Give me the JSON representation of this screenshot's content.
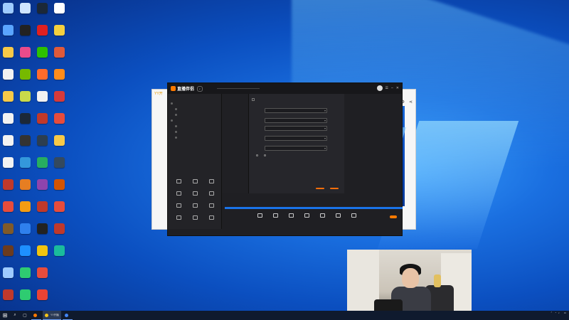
{
  "desktop": {
    "icons": [
      {
        "label": "",
        "icon": "recycle-bin-icon",
        "color": "#9ecbff"
      },
      {
        "label": "",
        "icon": "computer-icon",
        "color": "#cfe5ff"
      },
      {
        "label": "",
        "icon": "steam-icon",
        "color": "#1b2838"
      },
      {
        "label": "",
        "icon": "app-icon",
        "color": "#ffffff"
      },
      {
        "label": "",
        "icon": "network-icon",
        "color": "#5aa5ff"
      },
      {
        "label": "",
        "icon": "epic-icon",
        "color": "#222222"
      },
      {
        "label": "",
        "icon": "netease-icon",
        "color": "#e02020"
      },
      {
        "label": "",
        "icon": "game-icon",
        "color": "#f4d03f"
      },
      {
        "label": "",
        "icon": "folder-icon",
        "color": "#f7c948"
      },
      {
        "label": "",
        "icon": "app-icon",
        "color": "#e94b8b"
      },
      {
        "label": "",
        "icon": "wechat-icon",
        "color": "#2dc100"
      },
      {
        "label": "",
        "icon": "game-icon",
        "color": "#e05a3a"
      },
      {
        "label": "",
        "icon": "document-icon",
        "color": "#f2f2f2"
      },
      {
        "label": "",
        "icon": "nvidia-icon",
        "color": "#76b900"
      },
      {
        "label": "",
        "icon": "app-icon",
        "color": "#ff6b2b"
      },
      {
        "label": "",
        "icon": "app-icon",
        "color": "#ff8c1a"
      },
      {
        "label": "",
        "icon": "folder-icon",
        "color": "#f7c948"
      },
      {
        "label": "",
        "icon": "game-icon",
        "color": "#c9d94a"
      },
      {
        "label": "",
        "icon": "document-icon",
        "color": "#f2f2f2"
      },
      {
        "label": "",
        "icon": "game-icon",
        "color": "#d63a3a"
      },
      {
        "label": "",
        "icon": "document-icon",
        "color": "#f2f2f2"
      },
      {
        "label": "",
        "icon": "steam-icon",
        "color": "#1b2838"
      },
      {
        "label": "",
        "icon": "game-icon",
        "color": "#c0392b"
      },
      {
        "label": "",
        "icon": "game-icon",
        "color": "#e74c3c"
      },
      {
        "label": "",
        "icon": "document-icon",
        "color": "#f2f2f2"
      },
      {
        "label": "",
        "icon": "app-icon",
        "color": "#333333"
      },
      {
        "label": "",
        "icon": "app-icon",
        "color": "#2c3e50"
      },
      {
        "label": "",
        "icon": "folder-icon",
        "color": "#f7c948"
      },
      {
        "label": "",
        "icon": "document-icon",
        "color": "#f2f2f2"
      },
      {
        "label": "",
        "icon": "app-icon",
        "color": "#3498db"
      },
      {
        "label": "",
        "icon": "game-icon",
        "color": "#27ae60"
      },
      {
        "label": "",
        "icon": "game-icon",
        "color": "#34495e"
      },
      {
        "label": "",
        "icon": "game-icon",
        "color": "#c0392b"
      },
      {
        "label": "",
        "icon": "game-icon",
        "color": "#e67e22"
      },
      {
        "label": "",
        "icon": "game-icon",
        "color": "#8e44ad"
      },
      {
        "label": "",
        "icon": "game-icon",
        "color": "#d35400"
      },
      {
        "label": "",
        "icon": "game-icon",
        "color": "#e74c3c"
      },
      {
        "label": "",
        "icon": "game-icon",
        "color": "#f39c12"
      },
      {
        "label": "",
        "icon": "game-icon",
        "color": "#c0392b"
      },
      {
        "label": "",
        "icon": "game-icon",
        "color": "#e74c3c"
      },
      {
        "label": "",
        "icon": "game-icon",
        "color": "#7f5a2a"
      },
      {
        "label": "",
        "icon": "app-icon",
        "color": "#2f80ed"
      },
      {
        "label": "",
        "icon": "game-icon",
        "color": "#222222"
      },
      {
        "label": "",
        "icon": "game-icon",
        "color": "#c0392b"
      },
      {
        "label": "",
        "icon": "game-icon",
        "color": "#6b3b1f"
      },
      {
        "label": "",
        "icon": "qq-icon",
        "color": "#1e90ff"
      },
      {
        "label": "",
        "icon": "game-icon",
        "color": "#f1c40f"
      },
      {
        "label": "",
        "icon": "game-icon",
        "color": "#1abc9c"
      },
      {
        "label": "",
        "icon": "app-icon",
        "color": "#9ecbff"
      },
      {
        "label": "",
        "icon": "game-icon",
        "color": "#2ecc71"
      },
      {
        "label": "",
        "icon": "game-icon",
        "color": "#e74c3c"
      },
      {
        "label": "",
        "icon": "blank",
        "color": "transparent"
      },
      {
        "label": "",
        "icon": "app-icon",
        "color": "#c0392b"
      },
      {
        "label": "",
        "icon": "app-icon",
        "color": "#2ecc71"
      },
      {
        "label": "",
        "icon": "chrome-icon",
        "color": "#ea4335"
      },
      {
        "label": "",
        "icon": "blank",
        "color": "transparent"
      }
    ]
  },
  "bg_window": {
    "title": "YY开"
  },
  "app": {
    "brand": "直播伴侣",
    "notice": "",
    "left_tabs": [
      "",
      "",
      ""
    ],
    "scenes": [
      {
        "name": "",
        "sub": false
      },
      {
        "name": "",
        "sub": true
      },
      {
        "name": "",
        "sub": true
      },
      {
        "name": "",
        "sub": false
      },
      {
        "name": "",
        "sub": true
      },
      {
        "name": "",
        "sub": true
      },
      {
        "name": "",
        "sub": true
      }
    ],
    "toolbox_label": "",
    "tools": [
      "",
      "",
      "",
      "",
      "",
      "",
      "",
      "",
      "",
      "",
      "",
      ""
    ],
    "bottom_left": ""
  },
  "settings": {
    "nav_title": "",
    "nav_items": [
      "",
      "",
      "",
      "",
      "",
      "",
      ""
    ],
    "rows": [
      {
        "label": "",
        "value": ""
      },
      {
        "label": "",
        "value": "",
        "hint": ""
      },
      {
        "label": "",
        "value": ""
      },
      {
        "label": "",
        "value": ""
      },
      {
        "label": "",
        "value": ""
      }
    ],
    "check_label": "",
    "radio_label": "",
    "radio_options": [
      "",
      ""
    ],
    "confirm": "",
    "cancel": ""
  },
  "toolbar": {
    "items": [
      "",
      "",
      "",
      "",
      "",
      "",
      ""
    ],
    "go_live": ""
  },
  "taskbar": {
    "tasks": [
      {
        "label": "",
        "color": "#ff7a00",
        "active": false
      },
      {
        "label": "YY开播",
        "color": "#f5c518",
        "active": true
      },
      {
        "label": "",
        "color": "#4285f4",
        "active": false
      }
    ],
    "clock_time": "",
    "clock_date": ""
  }
}
